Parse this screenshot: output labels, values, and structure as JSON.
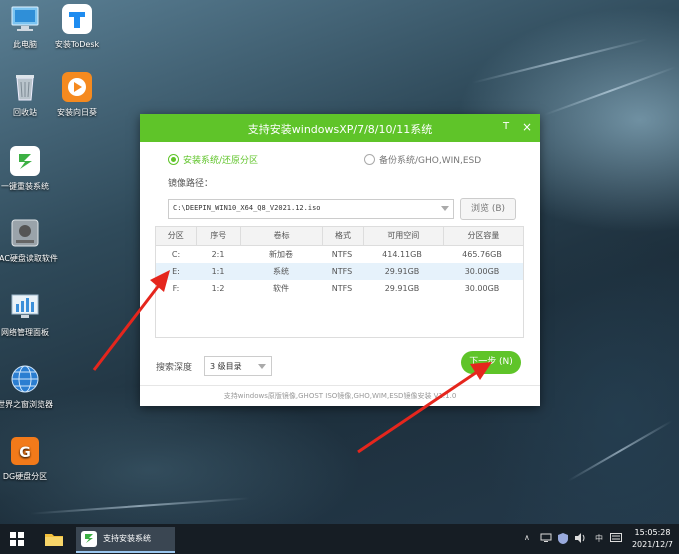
{
  "desktop": {
    "icons": [
      {
        "label": "此电脑",
        "icon": "computer-icon"
      },
      {
        "label": "安装ToDesk",
        "icon": "todesk-icon"
      },
      {
        "label": "回收站",
        "icon": "recycle-bin-icon"
      },
      {
        "label": "安装向日葵",
        "icon": "sunflower-icon"
      },
      {
        "label": "一键重装系统",
        "icon": "reinstall-system-icon"
      },
      {
        "label": "MAC硬盘读取软件",
        "icon": "mac-disk-icon"
      },
      {
        "label": "网络管理面板",
        "icon": "network-panel-icon"
      },
      {
        "label": "世界之窗浏览器",
        "icon": "browser-globe-icon"
      },
      {
        "label": "DG硬盘分区",
        "icon": "diskgenius-icon"
      }
    ]
  },
  "window": {
    "title": "支持安装windowsXP/7/8/10/11系统",
    "pin_glyph": "T",
    "close_glyph": "×",
    "radio_install": "安装系统/还原分区",
    "radio_backup": "备份系统/GHO,WIN,ESD",
    "image_path_label": "镜像路径：",
    "image_path_value": "C:\\DEEPIN_WIN10_X64_Q8_V2021.12.iso",
    "browse_label": "浏览 (B)",
    "table": {
      "headers": [
        "分区",
        "序号",
        "卷标",
        "格式",
        "可用空间",
        "分区容量"
      ],
      "rows": [
        [
          "C:",
          "2:1",
          "新加卷",
          "NTFS",
          "414.11GB",
          "465.76GB"
        ],
        [
          "E:",
          "1:1",
          "系统",
          "NTFS",
          "29.91GB",
          "30.00GB"
        ],
        [
          "F:",
          "1:2",
          "软件",
          "NTFS",
          "29.91GB",
          "30.00GB"
        ]
      ],
      "selected_row": 1
    },
    "search_depth_label": "搜索深度",
    "search_depth_value": "3 级目录",
    "next_label": "下一步 (N)",
    "footer_text": "支持windows原版镜像,GHOST ISO镜像,GHO,WIM,ESD镜像安装 V1.1.0"
  },
  "taskbar": {
    "active_app_label": "支持安装系统",
    "tray_lang": "中",
    "time": "15:05:28",
    "date": "2021/12/7"
  },
  "colors": {
    "accent_green": "#5fc429",
    "arrow_red": "#e5261d",
    "selected_row": "#e6f2fb",
    "taskbar": "#161d24"
  }
}
